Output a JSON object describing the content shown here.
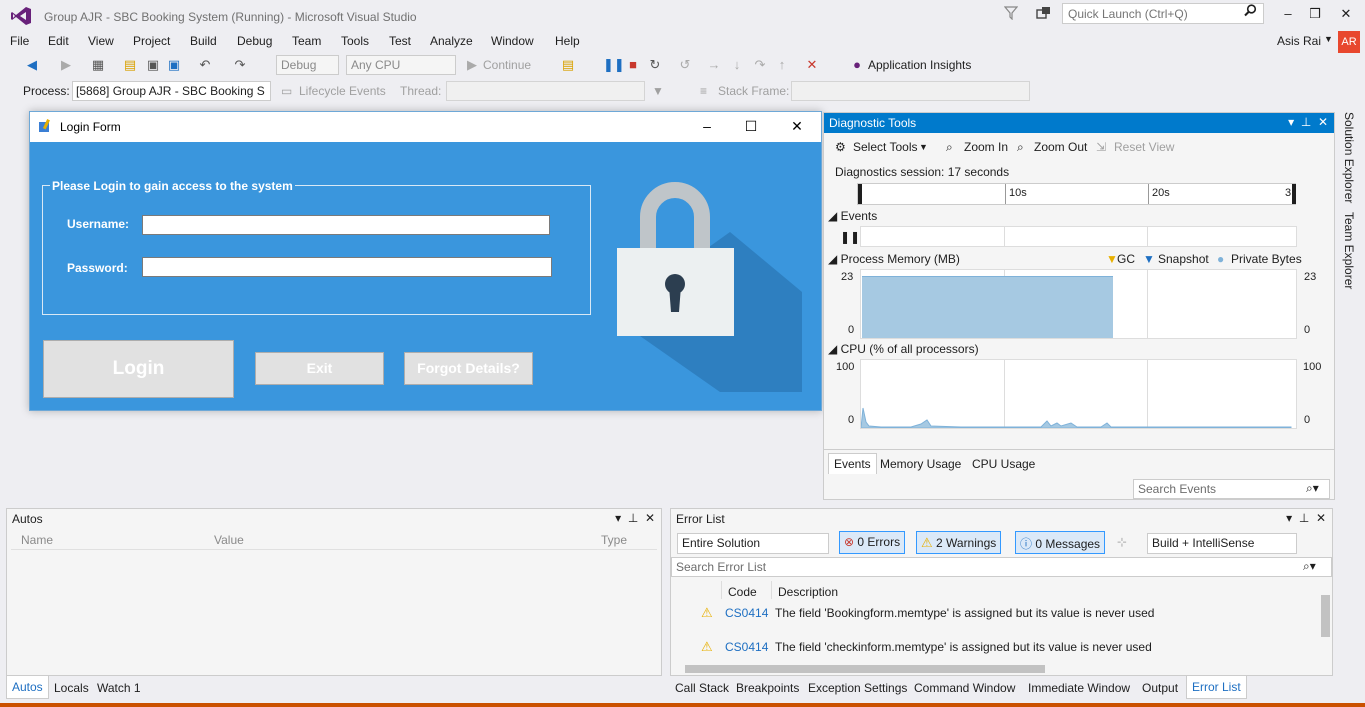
{
  "window": {
    "title": "Group AJR - SBC Booking System (Running) - Microsoft Visual Studio",
    "quick_launch_placeholder": "Quick Launch (Ctrl+Q)",
    "user_name": "Asis Rai",
    "avatar_initials": "AR",
    "controls": {
      "minimize": "–",
      "restore": "❒",
      "close": "✕"
    }
  },
  "menu": [
    "File",
    "Edit",
    "View",
    "Project",
    "Build",
    "Debug",
    "Team",
    "Tools",
    "Test",
    "Analyze",
    "Window",
    "Help"
  ],
  "toolbar": {
    "config": "Debug",
    "platform": "Any CPU",
    "continue_label": "Continue",
    "app_insights_label": "Application Insights"
  },
  "process_bar": {
    "process_label": "Process:",
    "process_value": "[5868] Group AJR - SBC Booking S",
    "lifecycle_label": "Lifecycle Events",
    "thread_label": "Thread:",
    "stack_frame_label": "Stack Frame:"
  },
  "login_form": {
    "title": "Login Form",
    "group_title": "Please Login to gain access to the system",
    "username_label": "Username:",
    "password_label": "Password:",
    "username_value": "",
    "password_value": "",
    "login_button": "Login",
    "exit_button": "Exit",
    "forgot_button": "Forgot Details?",
    "colors": {
      "background": "#3a96dd",
      "lock_shadow": "#2e7fc0",
      "lock_body": "#ecf0f1",
      "shackle": "#bfc5c9",
      "keyhole": "#2c3e50"
    }
  },
  "diagnostic_tools": {
    "title": "Diagnostic Tools",
    "select_tools": "Select Tools",
    "zoom_in": "Zoom In",
    "zoom_out": "Zoom Out",
    "reset_view": "Reset View",
    "session_text": "Diagnostics session: 17 seconds",
    "ruler_ticks": [
      "10s",
      "20s",
      "3"
    ],
    "events_label": "Events",
    "memory_label": "Process Memory (MB)",
    "memory_legend": [
      "GC",
      "Snapshot",
      "Private Bytes"
    ],
    "memory_max": "23",
    "memory_min": "0",
    "cpu_label": "CPU (% of all processors)",
    "cpu_max": "100",
    "cpu_min": "0",
    "tabs": [
      "Events",
      "Memory Usage",
      "CPU Usage"
    ],
    "search_placeholder": "Search Events"
  },
  "autos": {
    "title": "Autos",
    "columns": [
      "Name",
      "Value",
      "Type"
    ],
    "tabs": [
      "Autos",
      "Locals",
      "Watch 1"
    ]
  },
  "error_list": {
    "title": "Error List",
    "scope": "Entire Solution",
    "errors": "0 Errors",
    "warnings": "2 Warnings",
    "messages": "0 Messages",
    "build_filter": "Build + IntelliSense",
    "search_placeholder": "Search Error List",
    "columns": [
      "Code",
      "Description"
    ],
    "rows": [
      {
        "code": "CS0414",
        "description": "The field 'Bookingform.memtype' is assigned but its value is never used"
      },
      {
        "code": "CS0414",
        "description": "The field 'checkinform.memtype' is assigned but its value is never used"
      }
    ],
    "tabs": [
      "Call Stack",
      "Breakpoints",
      "Exception Settings",
      "Command Window",
      "Immediate Window",
      "Output",
      "Error List"
    ]
  },
  "side_rail": [
    "Solution Explorer",
    "Team Explorer"
  ]
}
